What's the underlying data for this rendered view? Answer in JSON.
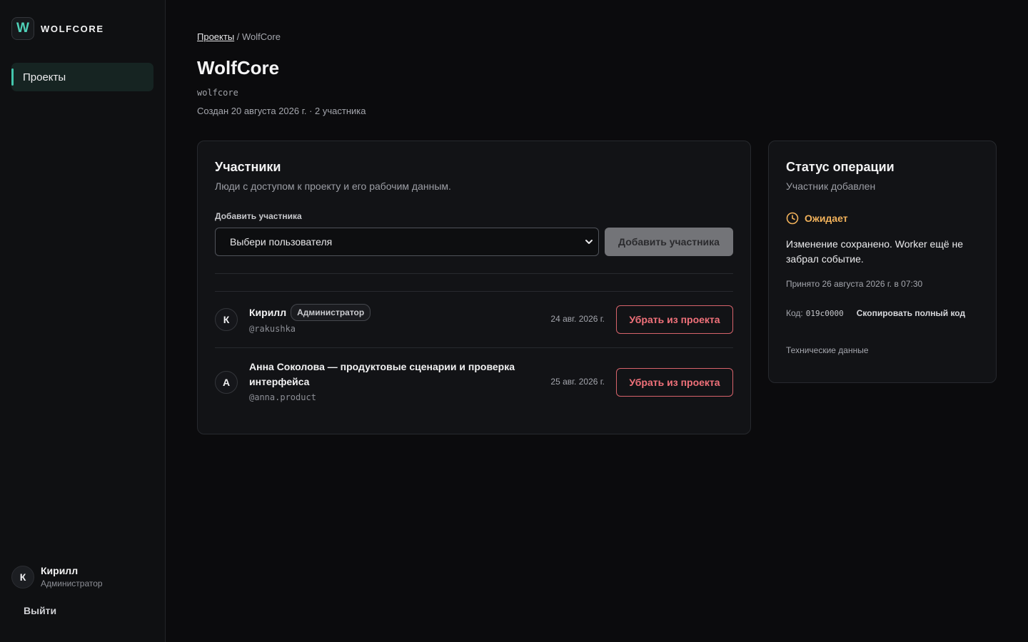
{
  "sidebar": {
    "brand": {
      "logo_letter": "W",
      "name": "WOLFCORE"
    },
    "nav": [
      {
        "label": "Проекты",
        "active": true
      }
    ],
    "user": {
      "initial": "К",
      "name": "Кирилл",
      "role": "Администратор"
    },
    "logout_label": "Выйти"
  },
  "header": {
    "breadcrumb": {
      "root": "Проекты",
      "separator": " / ",
      "current": "WolfCore"
    },
    "title": "WolfCore",
    "slug": "wolfcore",
    "meta": "Создан 20 августа 2026 г. · 2 участника"
  },
  "members": {
    "title": "Участники",
    "subtitle": "Люди с доступом к проекту и его рабочим данным.",
    "add_label": "Добавить участника",
    "select_placeholder": "Выбери пользователя",
    "add_button": "Добавить участника",
    "remove_label": "Убрать из проекта",
    "rows": [
      {
        "initial": "К",
        "name": "Кирилл",
        "badge": "Администратор",
        "handle": "@rakushka",
        "date": "24 авг. 2026 г."
      },
      {
        "initial": "А",
        "name": "Анна Соколова — продуктовые сценарии и проверка интерфейса",
        "handle": "@anna.product",
        "date": "25 авг. 2026 г."
      }
    ]
  },
  "status": {
    "title": "Статус операции",
    "subtitle": "Участник добавлен",
    "state": "Ожидает",
    "description": "Изменение сохранено. Worker ещё не забрал событие.",
    "accepted": "Принято 26 августа 2026 г. в 07:30",
    "code_label": "Код:",
    "code_value": "019c0000",
    "copy_label": "Скопировать полный код",
    "tech_label": "Технические данные"
  },
  "colors": {
    "accent": "#43c6ac",
    "warning": "#f2b25b",
    "danger": "#f0717a"
  }
}
